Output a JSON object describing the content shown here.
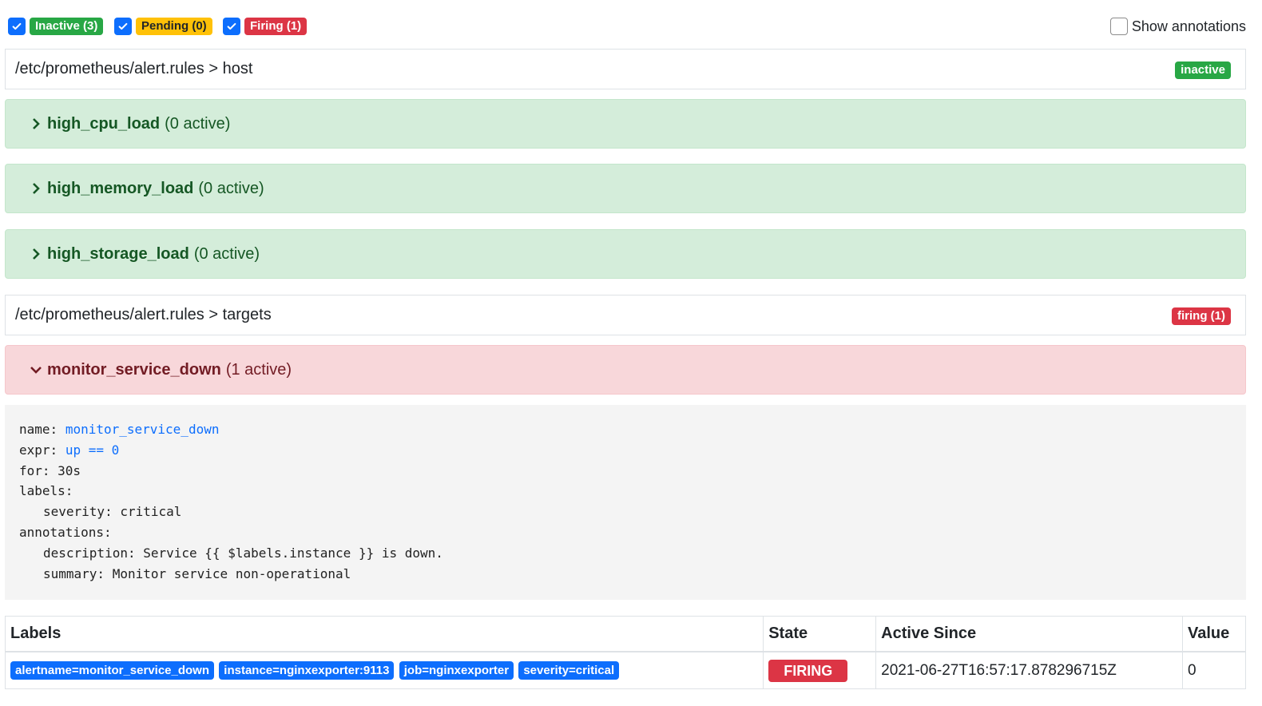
{
  "filters": [
    {
      "label": "Inactive (3)",
      "checked": true,
      "color": "#28a745"
    },
    {
      "label": "Pending (0)",
      "checked": true,
      "color": "#ffc107"
    },
    {
      "label": "Firing (1)",
      "checked": true,
      "color": "#dc3545"
    }
  ],
  "show_annotations": {
    "label": "Show annotations",
    "checked": false
  },
  "groups": [
    {
      "path": "/etc/prometheus/alert.rules > host",
      "badge": "inactive",
      "badge_color": "#28a745",
      "rules": [
        {
          "name": "high_cpu_load",
          "active": "(0 active)",
          "expanded": false
        },
        {
          "name": "high_memory_load",
          "active": "(0 active)",
          "expanded": false
        },
        {
          "name": "high_storage_load",
          "active": "(0 active)",
          "expanded": false
        }
      ]
    },
    {
      "path": "/etc/prometheus/alert.rules > targets",
      "badge": "firing (1)",
      "badge_color": "#dc3545",
      "rules": [
        {
          "name": "monitor_service_down",
          "active": "(1 active)",
          "expanded": true
        }
      ]
    }
  ],
  "rule_detail": {
    "name_key": "name:",
    "name_value": "monitor_service_down",
    "expr_key": "expr:",
    "expr_value": "up == 0",
    "for_line": "for: 30s",
    "labels_key": "labels:",
    "severity_line": "severity: critical",
    "annotations_key": "annotations:",
    "description_line": "description: Service {{ $labels.instance }} is down.",
    "summary_line": "summary: Monitor service non-operational"
  },
  "alerts_table": {
    "headers": [
      "Labels",
      "State",
      "Active Since",
      "Value"
    ],
    "rows": [
      {
        "labels": [
          "alertname=monitor_service_down",
          "instance=nginxexporter:9113",
          "job=nginxexporter",
          "severity=critical"
        ],
        "state": "FIRING",
        "active_since": "2021-06-27T16:57:17.878296715Z",
        "value": "0"
      }
    ]
  }
}
